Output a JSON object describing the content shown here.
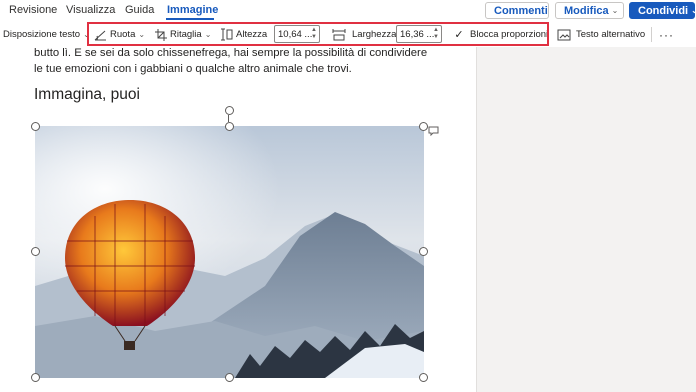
{
  "tabs": [
    "Revisione",
    "Visualizza",
    "Guida",
    "Immagine"
  ],
  "active_tab": "Immagine",
  "header_buttons": {
    "comments": "Commenti",
    "edit": "Modifica",
    "share": "Condividi"
  },
  "ribbon": {
    "wrap_text": "Disposizione testo",
    "rotate": "Ruota",
    "crop": "Ritaglia",
    "height_label": "Altezza",
    "height_value": "10,64 ...",
    "width_label": "Larghezza",
    "width_value": "16,36 ...",
    "lock_ratio": "Blocca proporzioni",
    "lock_ratio_checked": true,
    "alt_text": "Testo alternativo",
    "more": "···"
  },
  "document": {
    "line1": "butto lì. E se sei da solo chissenefrega, hai sempre la possibilità di condividere",
    "line2": "le tue emozioni con i gabbiani o qualche altro animale che trovi.",
    "heading": "Immagina, puoi"
  },
  "colors": {
    "accent": "#185abd",
    "highlight_box": "#e03041"
  },
  "icons": [
    "comment-icon",
    "pen-icon",
    "share-icon",
    "wrap-text-icon",
    "rotate-icon",
    "crop-icon",
    "height-icon",
    "width-icon",
    "checkbox-icon",
    "alt-text-icon",
    "rotate-handle-icon",
    "layout-options-icon"
  ]
}
